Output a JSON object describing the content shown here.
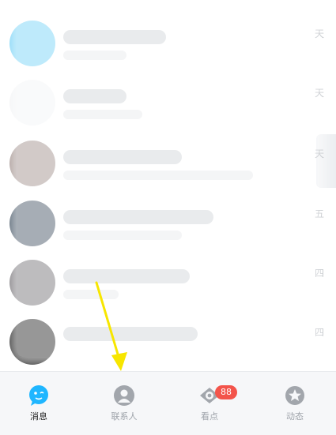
{
  "list_top_fragment": "",
  "rows": [
    {
      "time": "天",
      "avatar_color": "#6fd0f6"
    },
    {
      "time": "天",
      "avatar_color": "#f2f3f5"
    },
    {
      "time": "天",
      "avatar_color": "#9b8a86"
    },
    {
      "time": "五",
      "avatar_color": "#3a4b5c"
    },
    {
      "time": "四",
      "avatar_color": "#6e6b70"
    },
    {
      "time": "四",
      "avatar_color": "#1a1a1a"
    }
  ],
  "bottom_fragment": "",
  "tabs": [
    {
      "label": "消息",
      "icon": "chat-bubble-icon",
      "active": true
    },
    {
      "label": "联系人",
      "icon": "contact-person-icon",
      "active": false
    },
    {
      "label": "看点",
      "icon": "eye-icon",
      "active": false
    },
    {
      "label": "动态",
      "icon": "star-badge-icon",
      "active": false
    }
  ],
  "badge": "88",
  "colors": {
    "accent": "#1fb6ff",
    "badge": "#f3544b",
    "arrow": "#f7e600"
  }
}
